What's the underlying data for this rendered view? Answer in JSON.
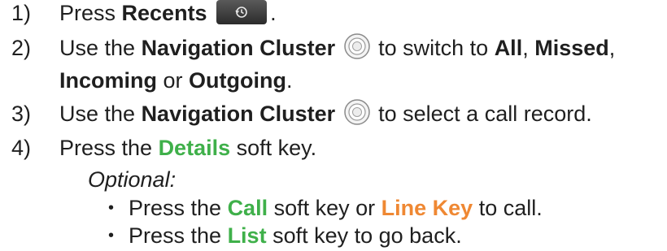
{
  "steps": [
    {
      "num": "1)",
      "a": "Press ",
      "b": "Recents",
      "c": "."
    },
    {
      "num": "2)",
      "a": "Use the ",
      "b": "Navigation Cluster",
      "c": " to switch to ",
      "d": "All",
      "e": ", ",
      "f": "Missed",
      "g": ","
    },
    {
      "line2a": "Incoming",
      "line2b": " or ",
      "line2c": "Outgoing",
      "line2d": "."
    },
    {
      "num": "3)",
      "a": "Use the ",
      "b": "Navigation Cluster",
      "c": " to select a call record."
    },
    {
      "num": "4)",
      "a": "Press the ",
      "b": "Details",
      "c": " soft key."
    }
  ],
  "optional": "Optional:",
  "bullets": [
    {
      "a": "Press the ",
      "b": "Call",
      "c": " soft key or ",
      "d": "Line Key",
      "e": " to call."
    },
    {
      "a": "Press the ",
      "b": "List",
      "c": " soft key to go back."
    }
  ],
  "bullet_char": "•",
  "colors": {
    "green": "#3fb04a",
    "orange": "#ef8833"
  },
  "icons": [
    "recents-clock-icon",
    "navigation-cluster-icon"
  ]
}
